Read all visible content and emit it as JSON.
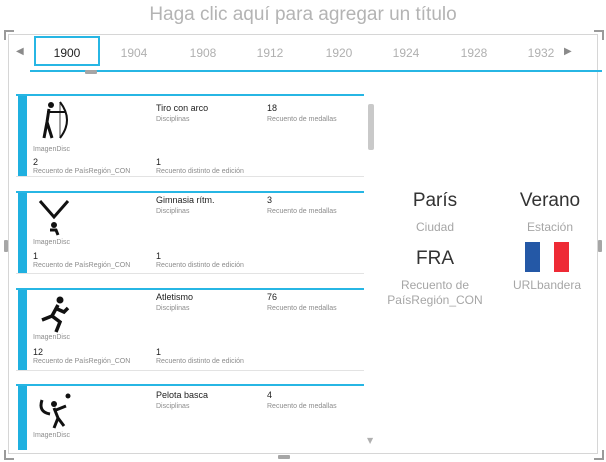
{
  "page": {
    "title": "Haga clic aquí para agregar un título"
  },
  "timeline": {
    "selected": "1900",
    "years": [
      "1900",
      "1904",
      "1908",
      "1912",
      "1920",
      "1924",
      "1928",
      "1932"
    ],
    "left_arrow": "◀",
    "right_arrow": "▶",
    "accent": "#27b6e4"
  },
  "list": {
    "image_label": "ImagenDisc",
    "disciplines_label": "Disciplinas",
    "medals_label": "Recuento de medallas",
    "country_label": "Recuento de PaísRegión_CON",
    "edition_label": "Recuento distinto de edición",
    "items": [
      {
        "icon": "archery-icon",
        "discipline": "Tiro con arco",
        "medals": "18",
        "countries": "2",
        "editions": "1"
      },
      {
        "icon": "rhythmic-gymnastics-icon",
        "discipline": "Gimnasia rítm.",
        "medals": "3",
        "countries": "1",
        "editions": "1"
      },
      {
        "icon": "athletics-icon",
        "discipline": "Atletismo",
        "medals": "76",
        "countries": "12",
        "editions": "1"
      },
      {
        "icon": "basque-pelota-icon",
        "discipline": "Pelota basca",
        "medals": "4",
        "countries": "",
        "editions": ""
      }
    ]
  },
  "cards": {
    "city": {
      "value": "París",
      "label": "Ciudad"
    },
    "season": {
      "value": "Verano",
      "label": "Estación"
    },
    "country": {
      "value": "FRA",
      "label": "Recuento de PaísRegión_CON"
    },
    "flag": {
      "label": "URLbandera",
      "colors": [
        "#2458a6",
        "#ffffff",
        "#ee2a35"
      ]
    }
  }
}
